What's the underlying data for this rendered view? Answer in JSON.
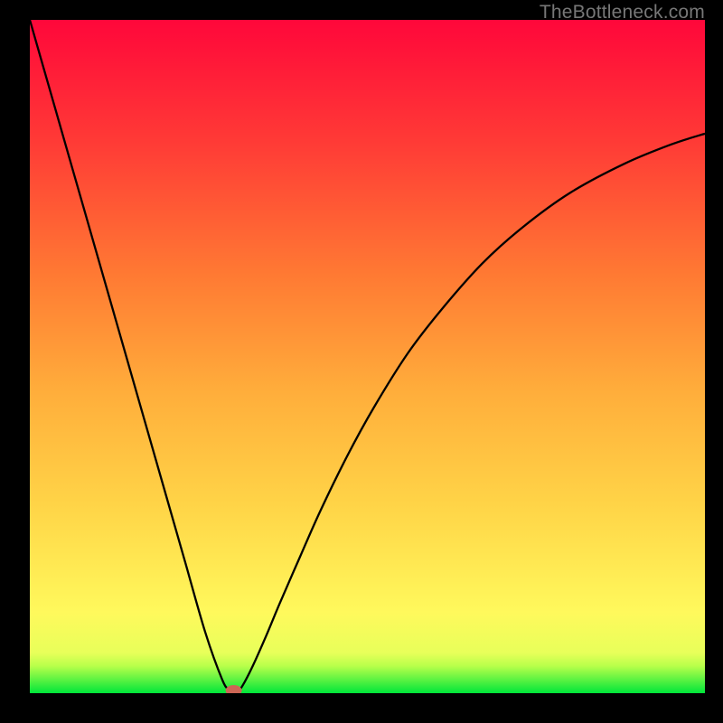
{
  "watermark": "TheBottleneck.com",
  "chart_data": {
    "type": "line",
    "title": "",
    "xlabel": "",
    "ylabel": "",
    "xlim": [
      0,
      100
    ],
    "ylim": [
      0,
      100
    ],
    "background_gradient": {
      "stops": [
        {
          "pos": 0.0,
          "color": "#00e63a"
        },
        {
          "pos": 0.04,
          "color": "#b7ff4a"
        },
        {
          "pos": 0.06,
          "color": "#e8ff5a"
        },
        {
          "pos": 0.12,
          "color": "#fff95c"
        },
        {
          "pos": 0.28,
          "color": "#ffd447"
        },
        {
          "pos": 0.45,
          "color": "#ffad3b"
        },
        {
          "pos": 0.62,
          "color": "#ff7a33"
        },
        {
          "pos": 0.82,
          "color": "#ff3a36"
        },
        {
          "pos": 1.0,
          "color": "#ff073a"
        }
      ]
    },
    "series": [
      {
        "name": "bottleneck-curve",
        "x": [
          0,
          2,
          5,
          8,
          11,
          14,
          17,
          20,
          23,
          26,
          28.5,
          29.5,
          30.2,
          30.8,
          31.5,
          33,
          35,
          37,
          40,
          43,
          47,
          51,
          56,
          61,
          67,
          73,
          80,
          88,
          95,
          100
        ],
        "y": [
          100,
          93,
          82.5,
          72,
          61.5,
          51,
          40.5,
          30,
          19.5,
          9,
          2,
          0.5,
          0,
          0.3,
          1.1,
          4,
          8.5,
          13.3,
          20.2,
          27,
          35.2,
          42.5,
          50.5,
          57,
          63.8,
          69.2,
          74.3,
          78.6,
          81.5,
          83.1
        ]
      }
    ],
    "minimum_marker": {
      "x": 30.2,
      "y": 0,
      "color": "#cc6655"
    }
  }
}
